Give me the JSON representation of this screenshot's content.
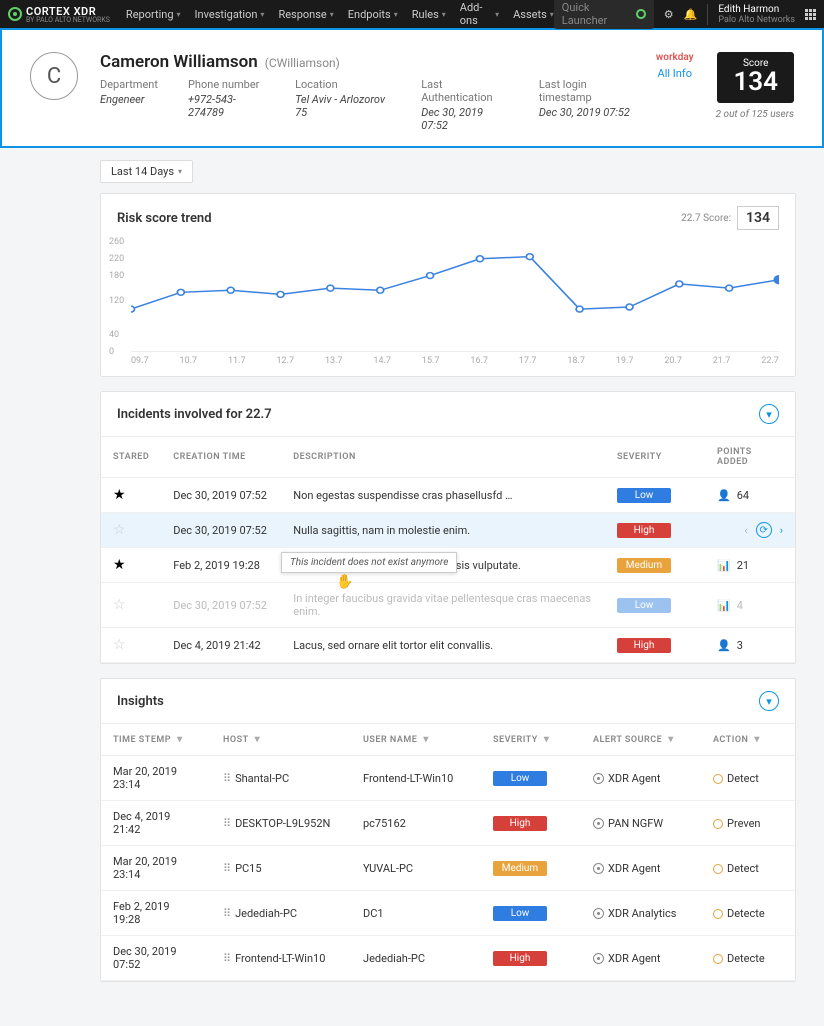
{
  "nav": {
    "brand": "CORTEX XDR",
    "brand_sub": "BY PALO ALTO NETWORKS",
    "items": [
      "Reporting",
      "Investigation",
      "Response",
      "Endpoits",
      "Rules",
      "Add-ons",
      "Assets"
    ],
    "quick_launcher": "Quick Launcher",
    "user_name": "Edith Harmon",
    "user_org": "Palo Alto Networks"
  },
  "hero": {
    "avatar_letter": "C",
    "name": "Cameron Williamson",
    "alias": "(CWilliamson)",
    "fields": [
      {
        "label": "Department",
        "value": "Engeneer"
      },
      {
        "label": "Phone number",
        "value": "+972-543-274789"
      },
      {
        "label": "Location",
        "value": "Tel Aviv - Arlozorov 75"
      },
      {
        "label": "Last Authentication",
        "value": "Dec 30, 2019 07:52"
      },
      {
        "label": "Last login timestamp",
        "value": "Dec 30, 2019 07:52"
      }
    ],
    "workday": "workday",
    "all_info": "All Info",
    "score_label": "Score",
    "score_value": "134",
    "rank": "2 out of 125 users"
  },
  "filter": {
    "label": "Last 14 Days"
  },
  "trend": {
    "title": "Risk score trend",
    "date_label": "22.7 Score:",
    "date_score": "134"
  },
  "chart_data": {
    "type": "line",
    "title": "Risk score trend",
    "xlabel": "",
    "ylabel": "",
    "ylim": [
      0,
      260
    ],
    "yticks": [
      0,
      40,
      120,
      180,
      220,
      260
    ],
    "x": [
      "09.7",
      "10.7",
      "11.7",
      "12.7",
      "13.7",
      "14.7",
      "15.7",
      "16.7",
      "17.7",
      "18.7",
      "19.7",
      "20.7",
      "21.7",
      "22.7"
    ],
    "values": [
      100,
      140,
      145,
      135,
      150,
      145,
      180,
      220,
      225,
      100,
      105,
      160,
      150,
      170
    ]
  },
  "incidents": {
    "title": "Incidents involved for 22.7",
    "columns": [
      "STARED",
      "CREATION TIME",
      "DESCRIPTION",
      "SEVERITY",
      "POINTS ADDED"
    ],
    "tooltip": "This incident does not exist anymore",
    "rows": [
      {
        "star": true,
        "time": "Dec 30, 2019 07:52",
        "desc": "Non egestas suspendisse cras phasellusfd …",
        "sev": "Low",
        "pts_icon": "person",
        "pts": "64"
      },
      {
        "star": false,
        "time": "Dec 30, 2019 07:52",
        "desc": "Nulla sagittis, nam in molestie enim.",
        "sev": "High",
        "pts_icon": "person",
        "pts": "",
        "hover": true
      },
      {
        "star": true,
        "time": "Feb 2, 2019 19:28",
        "desc": "Consectetur sit tincidunt vel facilisis vulputate.",
        "sev": "Medium",
        "pts_icon": "bars",
        "pts": "21"
      },
      {
        "star": false,
        "time": "Dec 30, 2019 07:52",
        "desc": "In integer faucibus gravida vitae pellentesque cras maecenas enim.",
        "sev": "Low",
        "pts_icon": "bars",
        "pts": "4",
        "disabled": true
      },
      {
        "star": false,
        "time": "Dec 4, 2019 21:42",
        "desc": "Lacus, sed ornare elit tortor elit convallis.",
        "sev": "High",
        "pts_icon": "person",
        "pts": "3"
      }
    ]
  },
  "insights": {
    "title": "Insights",
    "columns": [
      "TIME STEMP",
      "HOST",
      "USER NAME",
      "SEVERITY",
      "ALERT SOURCE",
      "ACTION"
    ],
    "rows": [
      {
        "time": "Mar 20, 2019 23:14",
        "host": "Shantal-PC",
        "user": "Frontend-LT-Win10",
        "sev": "Low",
        "src": "XDR Agent",
        "action": "Detect"
      },
      {
        "time": "Dec 4, 2019 21:42",
        "host": "DESKTOP-L9L952N",
        "user": "pc75162",
        "sev": "High",
        "src": "PAN NGFW",
        "action": "Preven"
      },
      {
        "time": "Mar 20, 2019 23:14",
        "host": "PC15",
        "user": "YUVAL-PC",
        "sev": "Medium",
        "src": "XDR Agent",
        "action": "Detect"
      },
      {
        "time": "Feb 2, 2019 19:28",
        "host": "Jedediah-PC",
        "user": "DC1",
        "sev": "Low",
        "src": "XDR Analytics",
        "action": "Detecte"
      },
      {
        "time": "Dec 30, 2019 07:52",
        "host": "Frontend-LT-Win10",
        "user": "Jedediah-PC",
        "sev": "High",
        "src": "XDR Agent",
        "action": "Detecte"
      }
    ]
  }
}
